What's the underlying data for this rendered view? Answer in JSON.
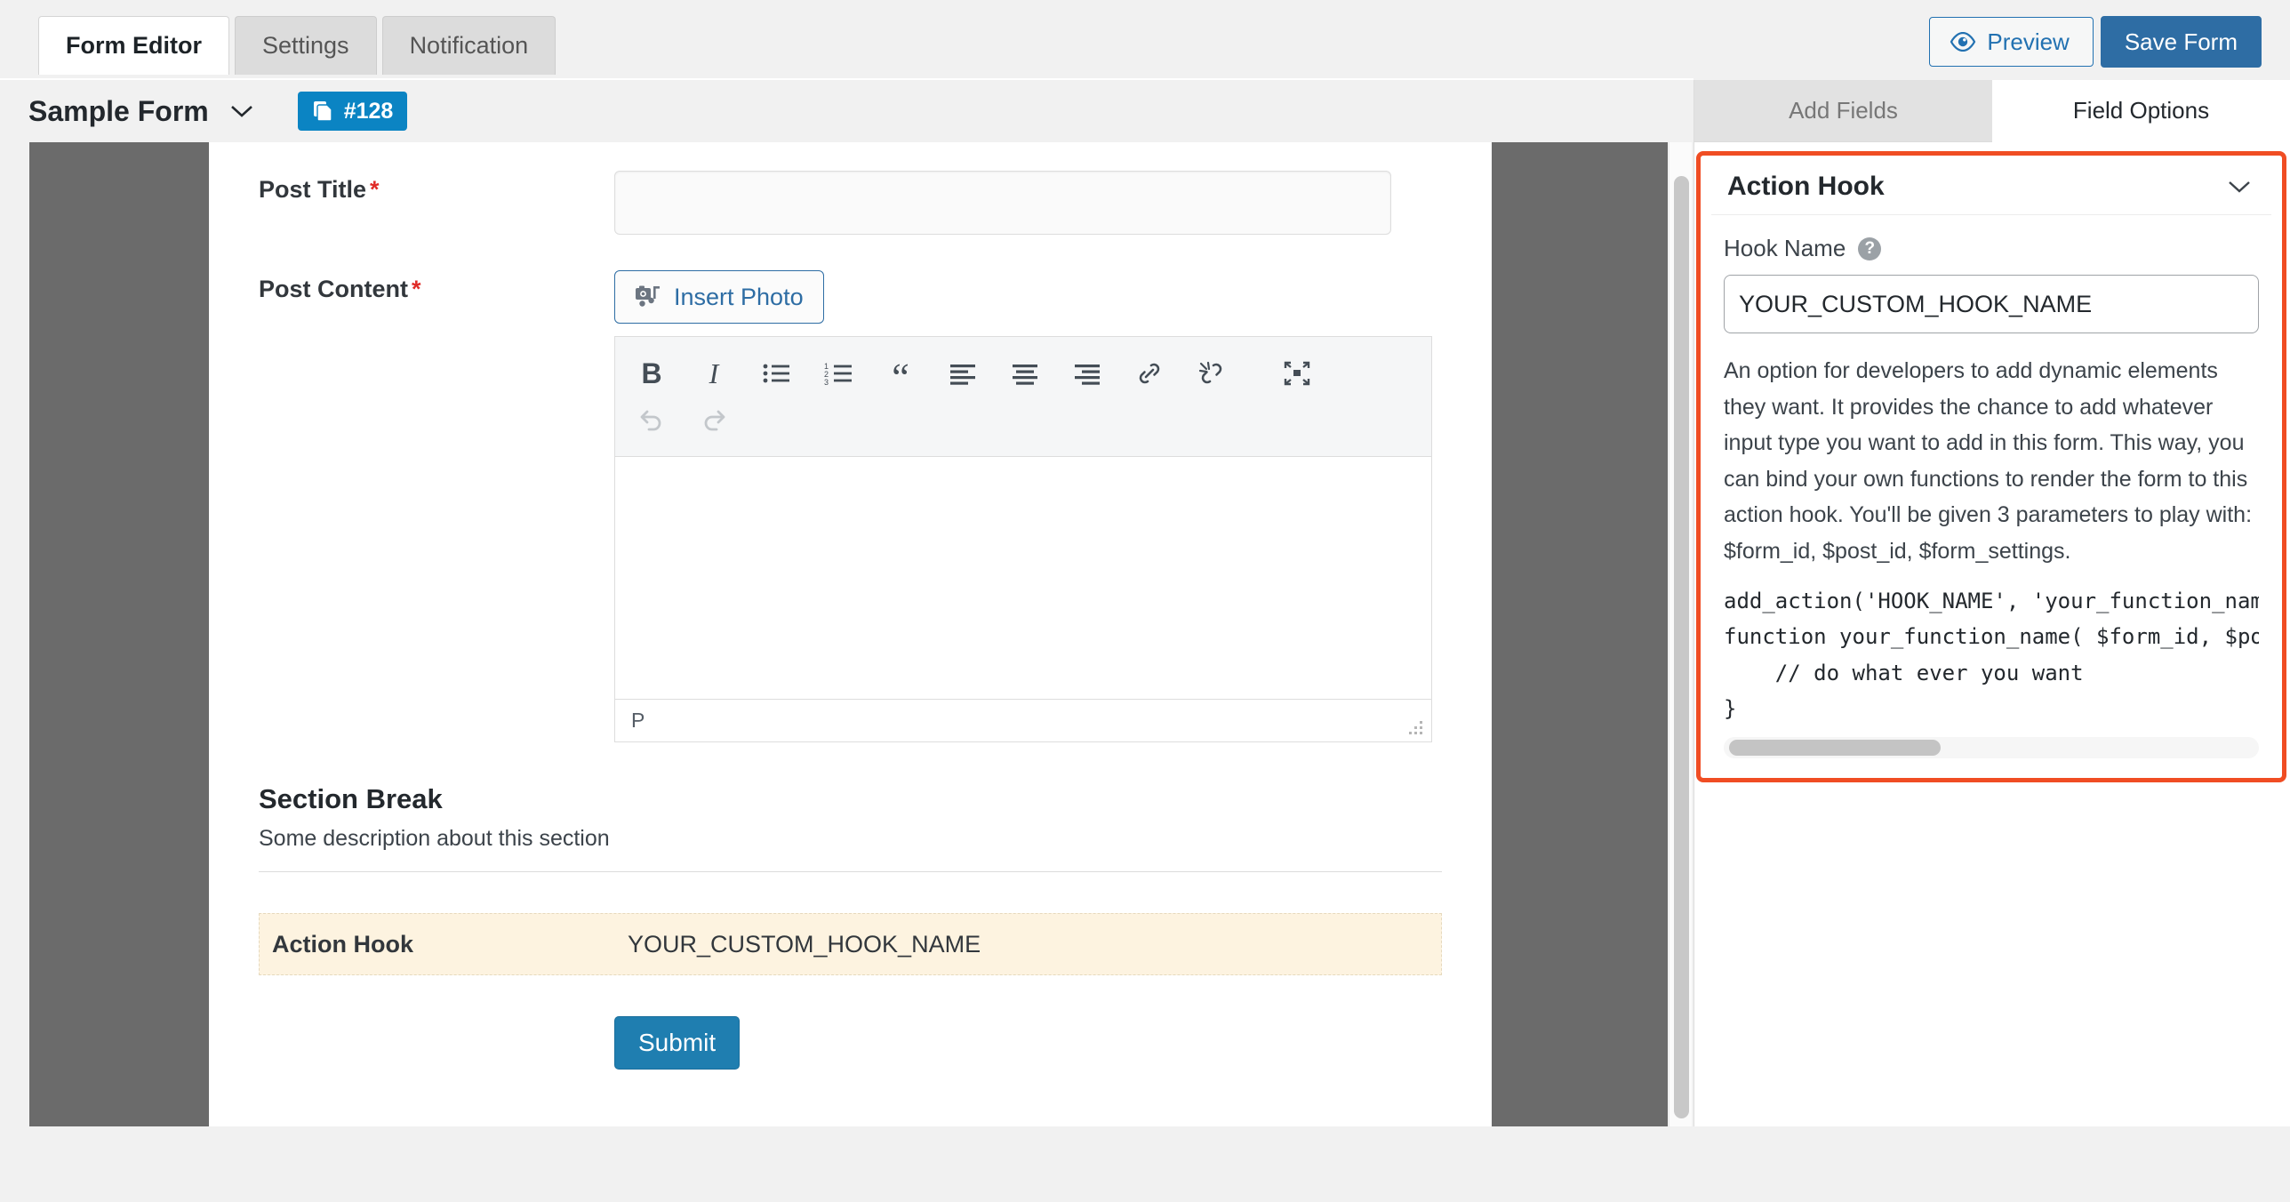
{
  "topbar": {
    "tabs": [
      {
        "label": "Form Editor",
        "active": true
      },
      {
        "label": "Settings",
        "active": false
      },
      {
        "label": "Notification",
        "active": false
      }
    ],
    "preview_label": "Preview",
    "save_label": "Save Form"
  },
  "form_header": {
    "title": "Sample Form",
    "shortcode": "#128"
  },
  "form_preview": {
    "fields": [
      {
        "label": "Post Title",
        "required": true,
        "type": "text",
        "value": ""
      },
      {
        "label": "Post Content",
        "required": true,
        "type": "richtext",
        "value": ""
      }
    ],
    "insert_photo_label": "Insert Photo",
    "editor_toolbar_row1": [
      "bold-icon",
      "italic-icon",
      "bulleted-list-icon",
      "numbered-list-icon",
      "blockquote-icon",
      "align-left-icon",
      "align-center-icon",
      "align-right-icon",
      "insert-link-icon",
      "remove-link-icon",
      "fullscreen-icon"
    ],
    "editor_toolbar_row2": [
      "undo-icon",
      "redo-icon"
    ],
    "editor_status_path": "P",
    "section_break": {
      "title": "Section Break",
      "description": "Some description about this section"
    },
    "action_hook_row": {
      "label": "Action Hook",
      "value": "YOUR_CUSTOM_HOOK_NAME"
    },
    "submit_label": "Submit"
  },
  "right_panel": {
    "tabs": [
      {
        "label": "Add Fields",
        "active": false
      },
      {
        "label": "Field Options",
        "active": true
      }
    ],
    "field_options": {
      "panel_title": "Action Hook",
      "hook_name_label": "Hook Name",
      "help_glyph": "?",
      "hook_name_value": "YOUR_CUSTOM_HOOK_NAME",
      "description": "An option for developers to add dynamic elements they want. It provides the chance to add whatever input type you want to add in this form. This way, you can bind your own functions to render the form to this action hook. You'll be given 3 parameters to play with: $form_id, $post_id, $form_settings.",
      "code_sample": "add_action('HOOK_NAME', 'your_function_name\nfunction your_function_name( $form_id, $post\n    // do what ever you want\n}"
    }
  },
  "colors": {
    "accent_blue": "#2e6da4",
    "badge_blue": "#0b84c3",
    "highlight_orange": "#f04d23",
    "required_red": "#e02b27",
    "hook_row_bg": "#fdf3e0",
    "overlay_gray": "#6b6b6b"
  }
}
